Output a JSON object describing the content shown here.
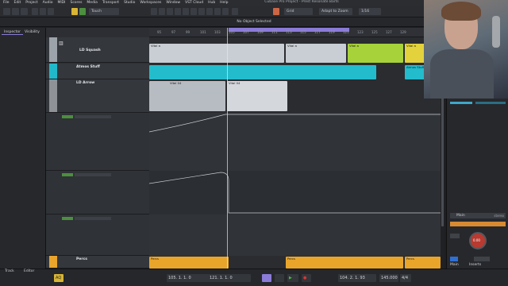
{
  "menubar": {
    "items": [
      "File",
      "Edit",
      "Project",
      "Audio",
      "MIDI",
      "Scores",
      "Media",
      "Transport",
      "Studio",
      "Workspaces",
      "Window",
      "VST Cloud",
      "Hub",
      "Help"
    ]
  },
  "window": {
    "title": "Cubase Pro Project - Prest Resonate Barts"
  },
  "toolbar": {
    "touch_mode": "Touch",
    "snap_type": "Grid",
    "snap_zoom": "Adapt to Zoom",
    "quantize": "1/16"
  },
  "infobar": {
    "text": "No Object Selected"
  },
  "inspector": {
    "tabs": [
      "Inspector",
      "Visibility"
    ]
  },
  "ruler": {
    "ticks": [
      "95",
      "97",
      "99",
      "101",
      "103",
      "105",
      "107",
      "109",
      "111",
      "113",
      "115",
      "117",
      "119",
      "121",
      "123",
      "125",
      "127",
      "129"
    ]
  },
  "tracks": [
    {
      "name": "LD Squash",
      "color": "#9ca3ab"
    },
    {
      "name": "Atmos Stuff",
      "color": "#21b9c9"
    },
    {
      "name": "LD Arrow",
      "color": "#8f9398"
    },
    {
      "name": "Percs",
      "color": "#e8a42b"
    }
  ],
  "parts": {
    "squash_label": "Vital a",
    "atmos_label": "Atmos Stuff",
    "arrow_label": "Vital 04",
    "percs_label": "Percs"
  },
  "mixer": {
    "channel_name": "Main",
    "channel_value": "stereo",
    "knob_value": "0.00",
    "tabs": [
      "Main",
      "Inserts"
    ]
  },
  "transport": {
    "left_locator": "105. 1. 1. 0",
    "right_locator": "121. 1. 1. 0",
    "position": "104. 2. 1. 93",
    "tempo": "145.000",
    "signature": "4/4",
    "tabs": [
      "Track",
      "Editor"
    ],
    "aq": "AQ"
  },
  "colors": {
    "accent": "#8b7bd8",
    "squash_part": "#c9ced4",
    "atmos_part": "#23bccc",
    "arrow_part": "#b7bcc2",
    "percs_part": "#e9a52a",
    "green_part": "#a7d23a",
    "yellow_part": "#e3d23c"
  }
}
